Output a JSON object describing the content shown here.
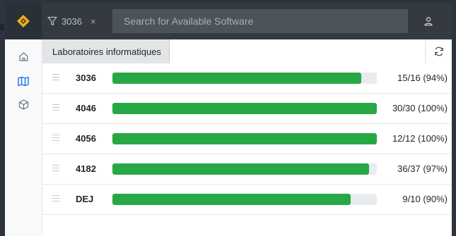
{
  "header": {
    "filter_chip": {
      "label": "3036",
      "clear_label": "×"
    },
    "search": {
      "placeholder": "Search for Available Software",
      "value": ""
    },
    "user_icon": "user-icon"
  },
  "sidebar": {
    "items": [
      {
        "icon": "home-icon"
      },
      {
        "icon": "map-icon",
        "active": true
      },
      {
        "icon": "cube-icon"
      }
    ]
  },
  "tabs": [
    {
      "label": "Laboratoires informatiques",
      "active": true
    }
  ],
  "labs": [
    {
      "name": "3036",
      "count": "15/16 (94%)",
      "fraction": 0.94
    },
    {
      "name": "4046",
      "count": "30/30 (100%)",
      "fraction": 1.0
    },
    {
      "name": "4056",
      "count": "12/12 (100%)",
      "fraction": 1.0
    },
    {
      "name": "4182",
      "count": "36/37 (97%)",
      "fraction": 0.97
    },
    {
      "name": "DEJ",
      "count": "9/10 (90%)",
      "fraction": 0.9
    }
  ],
  "colors": {
    "accent": "#f0ad1c",
    "bar_fill": "#28a745",
    "bar_track": "#e9ecef",
    "topbar": "#343a40",
    "active_icon": "#1a73e8"
  }
}
